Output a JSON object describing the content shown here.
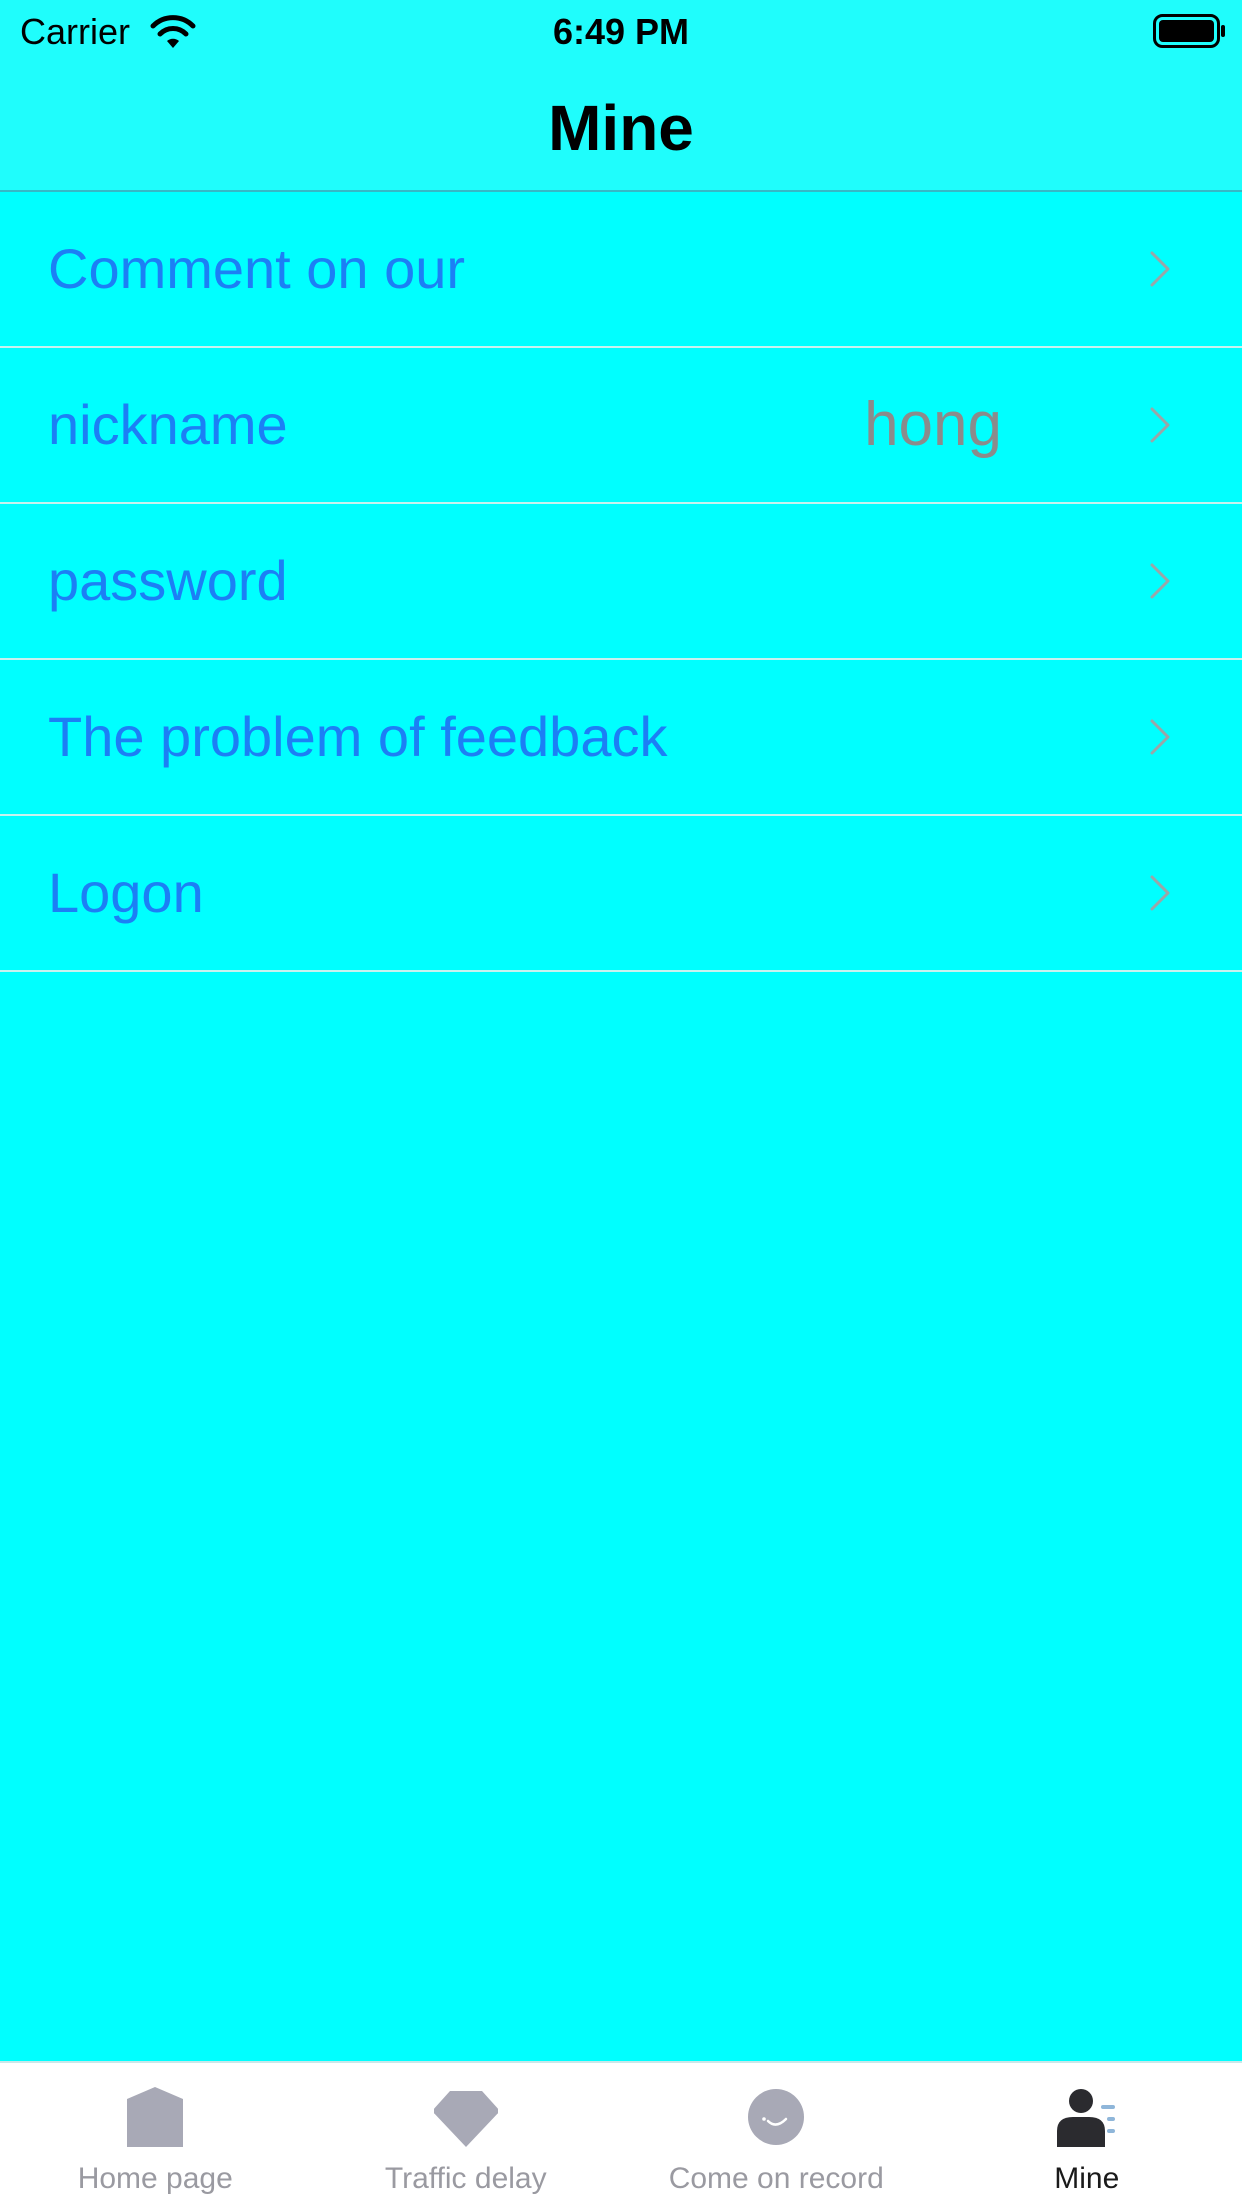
{
  "status_bar": {
    "carrier": "Carrier",
    "time": "6:49 PM",
    "wifi_icon": "wifi-icon",
    "battery_icon": "battery-full-icon"
  },
  "header": {
    "title": "Mine"
  },
  "settings": {
    "items": [
      {
        "label": "Comment on our",
        "value": ""
      },
      {
        "label": "nickname",
        "value": "hong"
      },
      {
        "label": "password",
        "value": ""
      },
      {
        "label": "The problem of feedback",
        "value": ""
      },
      {
        "label": "Logon",
        "value": ""
      }
    ],
    "chevron_icon": "chevron-right-icon"
  },
  "tab_bar": {
    "tabs": [
      {
        "label": "Home page",
        "icon": "home-icon",
        "active": false
      },
      {
        "label": "Traffic delay",
        "icon": "diamond-icon",
        "active": false
      },
      {
        "label": "Come on record",
        "icon": "smile-icon",
        "active": false
      },
      {
        "label": "Mine",
        "icon": "person-icon",
        "active": true
      }
    ]
  },
  "colors": {
    "background": "#00ffff",
    "header_background": "#1ffdfc",
    "row_label": "#1c7ff5",
    "row_value": "#8b8b8b",
    "tab_inactive": "#9a9aa1",
    "tab_active": "#1a1a1a"
  }
}
